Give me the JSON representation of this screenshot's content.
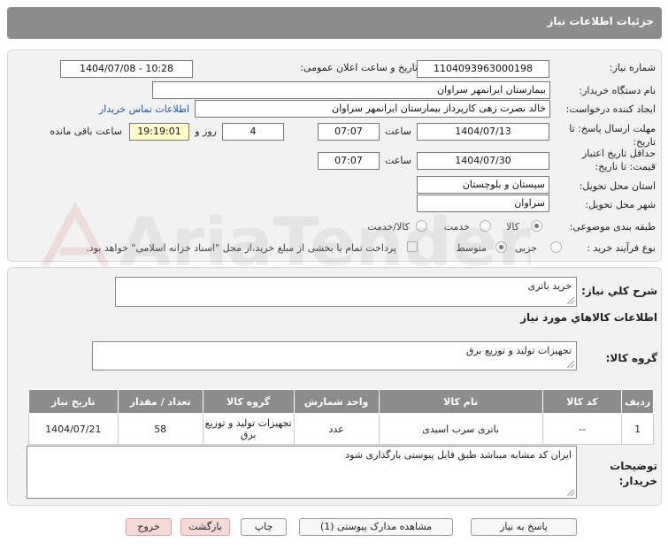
{
  "header": {
    "title": "جزئیات اطلاعات نیاز"
  },
  "form": {
    "need_number_label": "شماره نیاز:",
    "need_number": "1104093963000198",
    "announce_label": "تاریخ و ساعت اعلان عمومی:",
    "announce_value": "1404/07/08 - 10:28",
    "buyer_org_label": "نام دستگاه خریدار:",
    "buyer_org": "بیمارستان ایرانمهر سراوان",
    "creator_label": "ایجاد کننده درخواست:",
    "creator": "خالد نصرت زهی کارپرداز بیمارستان ایرانمهر سراوان",
    "contact_link": "اطلاعات تماس خریدار",
    "deadline_label": "مهلت ارسال پاسخ: تا تاریخ:",
    "deadline_date": "1404/07/13",
    "time_label": "ساعت",
    "deadline_time": "07:07",
    "days_value": "4",
    "days_label": "روز و",
    "remaining_time": "19:19:01",
    "remaining_label": "ساعت باقی مانده",
    "validity_label": "حداقل تاریخ اعتبار قیمت: تا تاریخ:",
    "validity_date": "1404/07/30",
    "validity_time": "07:07",
    "province_label": "استان محل تحویل:",
    "province": "سیستان و بلوچستان",
    "city_label": "شهر محل تحویل:",
    "city": "سراوان",
    "category_label": "طبقه بندی موضوعی:",
    "category_options": [
      "کالا",
      "خدمت",
      "کالا/خدمت"
    ],
    "process_label": "نوع فرآیند خرید :",
    "process_options": [
      "جزیی",
      "متوسط"
    ],
    "payment_note": "پرداخت تمام یا بخشی از مبلغ خرید،از محل \"اسناد خزانه اسلامی\" خواهد بود."
  },
  "summary": {
    "label": "شرح كلي نياز:",
    "value": "خرید باتری"
  },
  "goods": {
    "title": "اطلاعات کالاهاي مورد نياز",
    "group_label": "گروه کالا:",
    "group_value": "تجهیزات تولید و توزیع برق",
    "columns": [
      "ردیف",
      "کد کالا",
      "نام کالا",
      "واحد شمارش",
      "گروه کالا",
      "تعداد / مقدار",
      "تاریخ نیاز"
    ],
    "rows": [
      [
        "1",
        "--",
        "باتری سرب اسیدی",
        "عدد",
        "تجهیزات تولید و توزیع برق",
        "58",
        "1404/07/21"
      ]
    ]
  },
  "buyer_notes": {
    "label": "توضیحات خریدار:",
    "value": "ایران کد مشابه میباشد طبق فایل پیوستی بارگذاری شود"
  },
  "buttons": {
    "reply": "پاسخ به نیاز",
    "attachments": "مشاهده مدارک پیوستی (1)",
    "print": "چاپ",
    "back": "بازگشت",
    "exit": "خروج"
  },
  "colors": {
    "header": "#8c8c8c",
    "highlight": "#ffffcc",
    "link": "#1a56b8"
  }
}
